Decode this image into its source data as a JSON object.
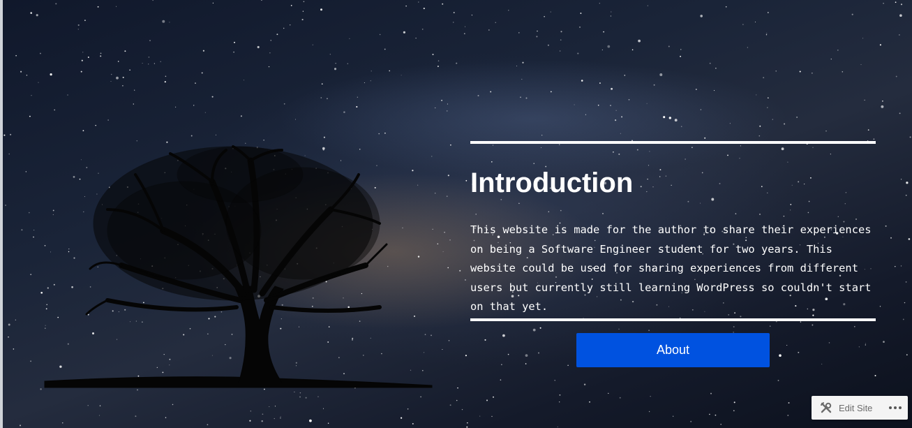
{
  "intro": {
    "title": "Introduction",
    "body": "This website is made for the author to share their experiences on being a Software Engineer student for two years. This website could be used for sharing experiences from different users but currently still learning WordPress so couldn't start on that yet."
  },
  "about_button": {
    "label": "About",
    "color": "#0052e0"
  },
  "admin_bar": {
    "edit_label": "Edit Site",
    "edit_icon": "tools-icon",
    "more_icon": "more-horizontal-icon"
  },
  "background": {
    "description_icon": "starry-sky-tree-image"
  }
}
